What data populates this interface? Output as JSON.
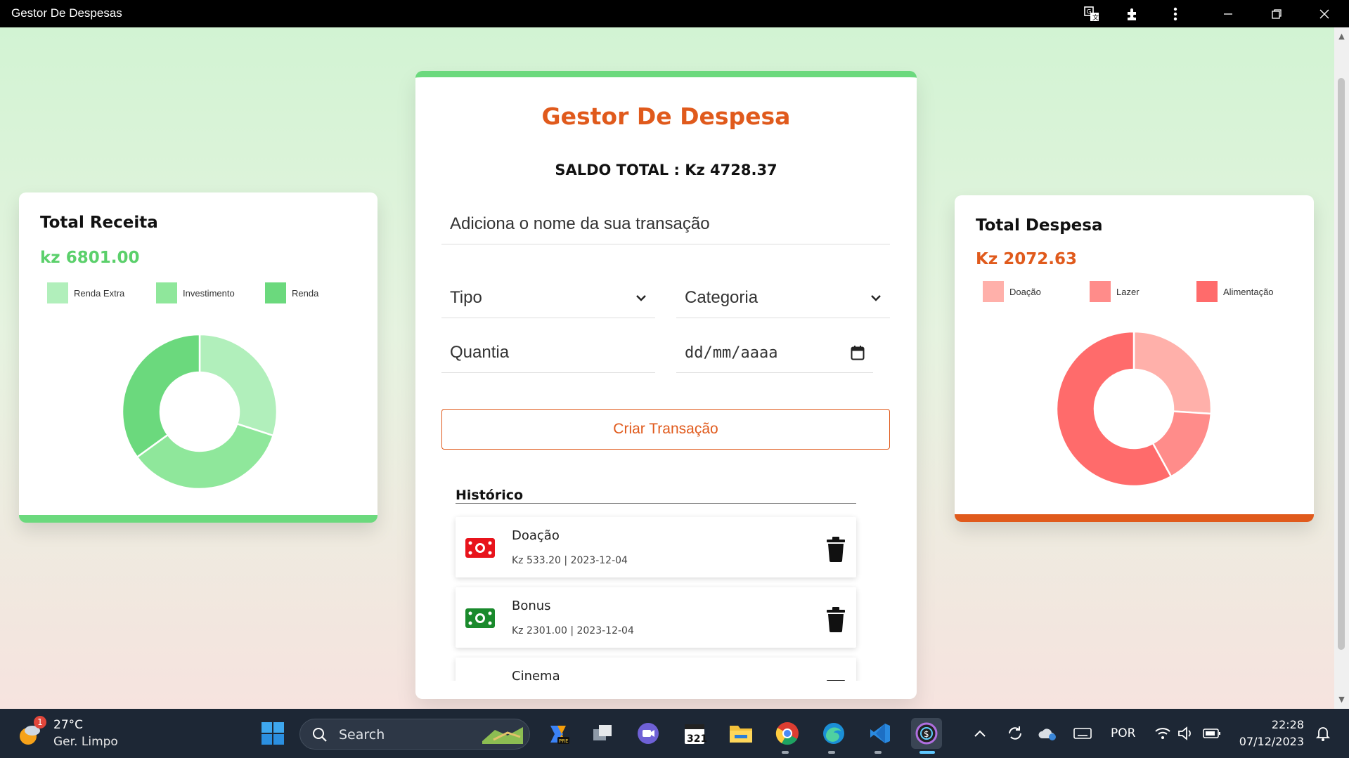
{
  "window": {
    "title": "Gestor De Despesas"
  },
  "app": {
    "title": "Gestor De Despesa",
    "balance_label": "SALDO TOTAL : Kz 4728.37",
    "name_placeholder": "Adiciona o nome da sua transação",
    "type_select": "Tipo",
    "category_select": "Categoria",
    "amount_placeholder": "Quantia",
    "date_placeholder": "dd/mm/aaaa",
    "create_button": "Criar Transação",
    "history_title": "Histórico",
    "history": [
      {
        "name": "Doação",
        "meta": "Kz 533.20 | 2023-12-04",
        "icon": "expense-money-icon",
        "color": "#e8141c"
      },
      {
        "name": "Bonus",
        "meta": "Kz 2301.00 | 2023-12-04",
        "icon": "income-money-icon",
        "color": "#1a8a2c"
      },
      {
        "name": "Cinema",
        "meta": "",
        "icon": "expense-money-icon",
        "color": "#e8141c"
      }
    ]
  },
  "income_card": {
    "title": "Total Receita",
    "amount": "kz 6801.00",
    "amount_color": "#5bd06b",
    "legend": [
      {
        "label": "Renda Extra",
        "color": "#b1efbb"
      },
      {
        "label": "Investimento",
        "color": "#8fe79b"
      },
      {
        "label": "Renda",
        "color": "#6bd97d"
      }
    ],
    "chart_data": {
      "type": "pie",
      "categories": [
        "Renda Extra",
        "Investimento",
        "Renda"
      ],
      "values": [
        0.3,
        0.35,
        0.35
      ],
      "donut": true
    }
  },
  "expense_card": {
    "title": "Total Despesa",
    "amount": "Kz 2072.63",
    "amount_color": "#e05a1c",
    "legend": [
      {
        "label": "Doação",
        "color": "#ffb0aa"
      },
      {
        "label": "Lazer",
        "color": "#ff8c8a"
      },
      {
        "label": "Alimentação",
        "color": "#ff6b6b"
      }
    ],
    "chart_data": {
      "type": "pie",
      "categories": [
        "Doação",
        "Lazer",
        "Alimentação"
      ],
      "values": [
        0.26,
        0.16,
        0.58
      ],
      "donut": true
    }
  },
  "taskbar": {
    "temperature": "27°C",
    "weather": "Ger. Limpo",
    "weather_badge": "1",
    "search_label": "Search",
    "language": "POR",
    "time": "22:28",
    "date": "07/12/2023"
  }
}
